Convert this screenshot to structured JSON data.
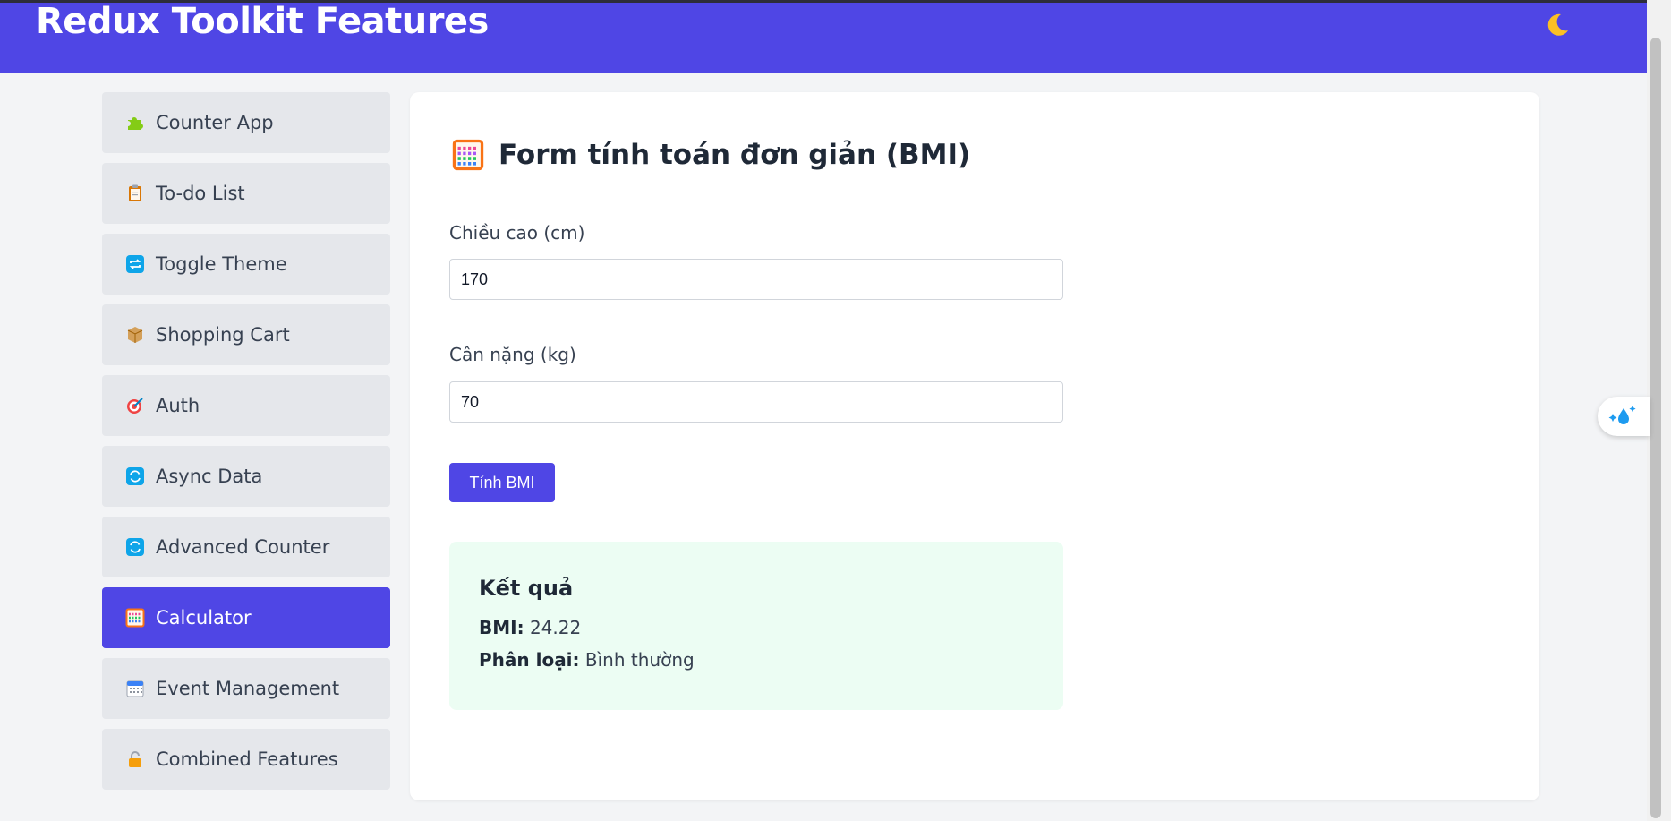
{
  "header": {
    "title": "Redux Toolkit Features",
    "theme_icon": "moon-icon"
  },
  "sidebar": {
    "items": [
      {
        "label": "Counter App",
        "icon": "puzzle-icon",
        "active": false
      },
      {
        "label": "To-do List",
        "icon": "clipboard-icon",
        "active": false
      },
      {
        "label": "Toggle Theme",
        "icon": "repeat-icon",
        "active": false
      },
      {
        "label": "Shopping Cart",
        "icon": "package-icon",
        "active": false
      },
      {
        "label": "Auth",
        "icon": "target-icon",
        "active": false
      },
      {
        "label": "Async Data",
        "icon": "refresh-icon",
        "active": false
      },
      {
        "label": "Advanced Counter",
        "icon": "refresh-icon",
        "active": false
      },
      {
        "label": "Calculator",
        "icon": "abacus-icon",
        "active": true
      },
      {
        "label": "Event Management",
        "icon": "calendar-icon",
        "active": false
      },
      {
        "label": "Combined Features",
        "icon": "lock-icon",
        "active": false
      }
    ]
  },
  "form": {
    "heading": "Form tính toán đơn giản (BMI)",
    "height_label": "Chiều cao (cm)",
    "height_value": "170",
    "weight_label": "Cân nặng (kg)",
    "weight_value": "70",
    "button_label": "Tính BMI"
  },
  "result": {
    "title": "Kết quả",
    "bmi_label": "BMI:",
    "bmi_value": "24.22",
    "category_label": "Phân loại:",
    "category_value": "Bình thường"
  },
  "colors": {
    "accent": "#4f46e5",
    "result_bg": "#ecfdf3",
    "page_bg": "#f3f4f6"
  }
}
